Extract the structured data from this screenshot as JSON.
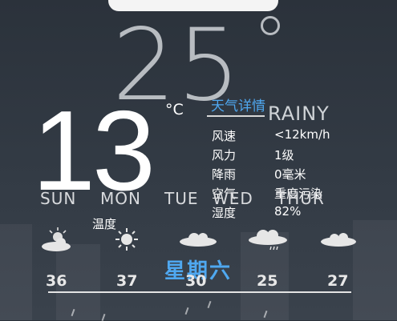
{
  "current": {
    "big_temp": "25",
    "temp": "13",
    "unit": "°C",
    "condition": "RAINY"
  },
  "details": {
    "title": "天气详情",
    "rows": [
      {
        "label": "风速",
        "value": "<12km/h"
      },
      {
        "label": "风力",
        "value": "1级"
      },
      {
        "label": "降雨",
        "value": "0毫米"
      },
      {
        "label": "空气",
        "value": "重度污染"
      },
      {
        "label": "湿度",
        "value": "82%"
      }
    ]
  },
  "week": {
    "days": [
      "SUN",
      "MON",
      "TUE",
      "WED",
      "THUR"
    ],
    "temp_label": "温度",
    "selected_day": "星期六",
    "highs": [
      "36",
      "37",
      "30",
      "25",
      "27"
    ],
    "icons": [
      "sun-behind-cloud-icon",
      "sun-icon",
      "cloud-icon",
      "rain-cloud-icon",
      "cloud-icon"
    ]
  },
  "colors": {
    "accent": "#4fa8f0",
    "background": "#2f3640"
  }
}
